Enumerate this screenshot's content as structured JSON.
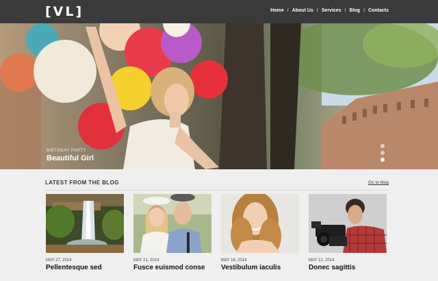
{
  "header": {
    "logo": "[VL]",
    "nav": [
      "Home",
      "About Us",
      "Services",
      "Blog",
      "Contacts"
    ],
    "separator": "/"
  },
  "hero": {
    "kicker": "BIRTHDAY PARTY",
    "title": "Beautiful Girl",
    "slides_total": 3,
    "active_slide": 3
  },
  "blog": {
    "heading": "LATEST FROM THE BLOG",
    "link": "Go to blog",
    "posts": [
      {
        "date": "MAY 27, 2014",
        "title": "Pellentesque sed",
        "image": "waterfall"
      },
      {
        "date": "MAY 21, 2014",
        "title": "Fusce euismod conse",
        "image": "couple"
      },
      {
        "date": "MAY 16, 2014",
        "title": "Vestibulum iaculis",
        "image": "smiling-woman"
      },
      {
        "date": "MAY 12, 2014",
        "title": "Donec sagittis",
        "image": "cameraman"
      }
    ]
  },
  "colors": {
    "header_bg": "#3a3a3a",
    "page_bg": "#efefef",
    "text": "#222222"
  }
}
